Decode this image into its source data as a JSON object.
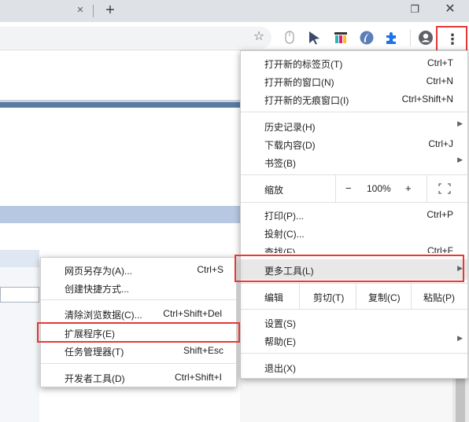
{
  "window": {
    "tab_close_icon": "×",
    "new_tab_icon": "+",
    "restore_icon": "❐",
    "close_icon": "✕"
  },
  "toolbar": {
    "bookmark_star_icon": "☆",
    "menu_icon": "⋮"
  },
  "menu": {
    "new_tab": {
      "label": "打开新的标签页(T)",
      "shortcut": "Ctrl+T"
    },
    "new_window": {
      "label": "打开新的窗口(N)",
      "shortcut": "Ctrl+N"
    },
    "new_incognito": {
      "label": "打开新的无痕窗口(I)",
      "shortcut": "Ctrl+Shift+N"
    },
    "history": {
      "label": "历史记录(H)"
    },
    "downloads": {
      "label": "下载内容(D)",
      "shortcut": "Ctrl+J"
    },
    "bookmarks": {
      "label": "书签(B)"
    },
    "zoom": {
      "label": "缩放",
      "minus": "−",
      "value": "100%",
      "plus": "+"
    },
    "print": {
      "label": "打印(P)...",
      "shortcut": "Ctrl+P"
    },
    "cast": {
      "label": "投射(C)..."
    },
    "find": {
      "label": "查找(F)...",
      "shortcut": "Ctrl+F"
    },
    "more_tools": {
      "label": "更多工具(L)"
    },
    "edit": {
      "label": "编辑",
      "cut": "剪切(T)",
      "copy": "复制(C)",
      "paste": "粘贴(P)"
    },
    "settings": {
      "label": "设置(S)"
    },
    "help": {
      "label": "帮助(E)"
    },
    "exit": {
      "label": "退出(X)"
    }
  },
  "submenu": {
    "save_page": {
      "label": "网页另存为(A)...",
      "shortcut": "Ctrl+S"
    },
    "create_shortcut": {
      "label": "创建快捷方式..."
    },
    "clear_data": {
      "label": "清除浏览数据(C)...",
      "shortcut": "Ctrl+Shift+Del"
    },
    "extensions": {
      "label": "扩展程序(E)"
    },
    "task_manager": {
      "label": "任务管理器(T)",
      "shortcut": "Shift+Esc"
    },
    "dev_tools": {
      "label": "开发者工具(D)",
      "shortcut": "Ctrl+Shift+I"
    }
  },
  "colors": {
    "highlight_border": "#e53935",
    "hover_bg": "#e8e8e8"
  }
}
